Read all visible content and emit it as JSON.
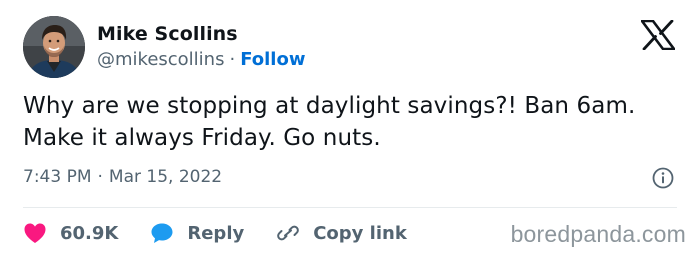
{
  "author": {
    "display_name": "Mike Scollins",
    "handle": "@mikescollins",
    "separator": "·",
    "follow_label": "Follow",
    "avatar_icon": "avatar-photo",
    "follow_color": "#006fd6"
  },
  "brand": {
    "logo_icon": "x-logo-icon"
  },
  "tweet": {
    "text": "Why are we stopping at daylight savings?! Ban 6am. Make it always Friday. Go nuts.",
    "time": "7:43 PM",
    "separator": "·",
    "date": "Mar 15, 2022",
    "info_icon": "info-icon"
  },
  "actions": {
    "likes": {
      "icon": "heart-icon",
      "count": "60.9K",
      "color": "#f91880"
    },
    "reply": {
      "icon": "reply-bubble-icon",
      "label": "Reply",
      "color": "#1d9bf0"
    },
    "copy_link": {
      "icon": "link-icon",
      "label": "Copy link"
    }
  },
  "watermark": {
    "text": "boredpanda.com"
  }
}
